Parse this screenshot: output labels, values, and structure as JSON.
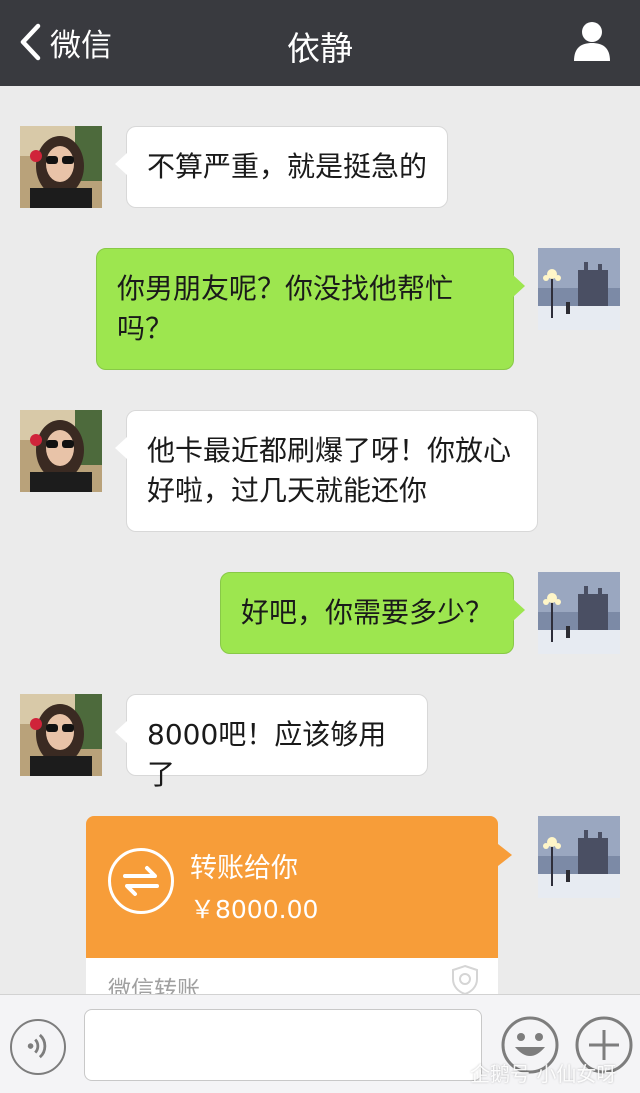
{
  "header": {
    "back_label": "微信",
    "title": "依静"
  },
  "messages": [
    {
      "side": "in",
      "text": "不算严重，就是挺急的"
    },
    {
      "side": "out",
      "lines": [
        "你男朋友呢？你没找他帮忙",
        "吗？"
      ]
    },
    {
      "side": "in",
      "lines": [
        "他卡最近都刷爆了呀！你放心",
        "好啦，过几天就能还你"
      ]
    },
    {
      "side": "out",
      "text": "好吧，你需要多少？"
    },
    {
      "side": "in",
      "text": "8000吧！应该够用了"
    }
  ],
  "transfer": {
    "title": "转账给你",
    "amount": "￥8000.00",
    "label": "微信转账"
  },
  "watermark": "企鹅号 小仙女呀",
  "colors": {
    "header_bg": "#393a3f",
    "chat_bg": "#ebebeb",
    "out_bubble": "#9de64f",
    "transfer_orange": "#f79d39"
  },
  "icons": {
    "back": "chevron-left-icon",
    "profile": "person-icon",
    "voice": "voice-icon",
    "emoji": "emoji-icon",
    "plus": "plus-icon",
    "transfer": "transfer-arrows-icon",
    "shield": "shield-icon"
  }
}
